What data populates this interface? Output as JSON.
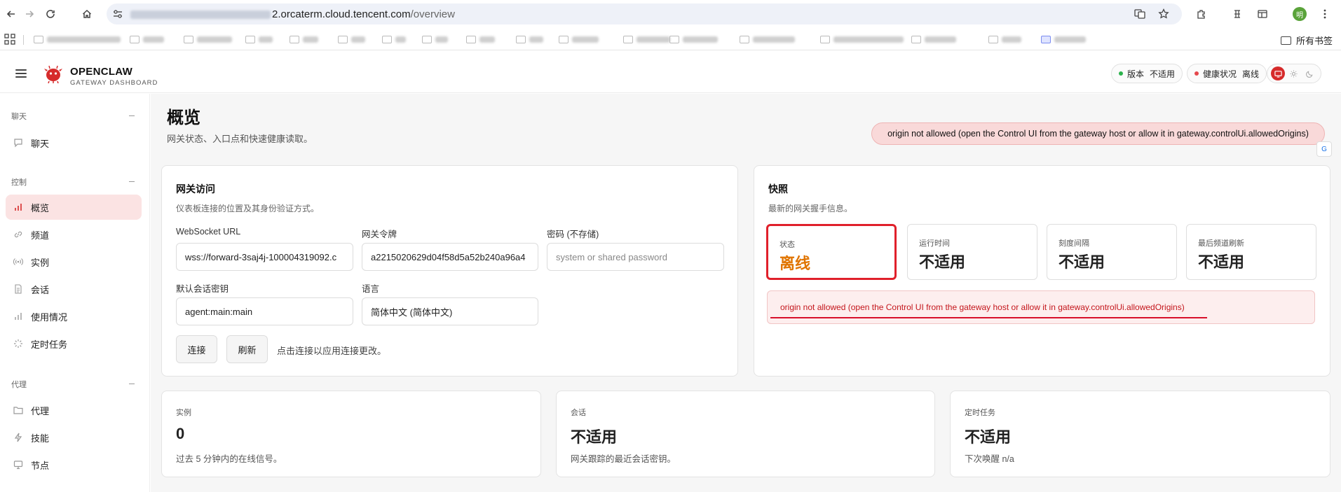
{
  "browser": {
    "url_host": "2.orcaterm.cloud.tencent.com",
    "url_path": "/overview",
    "all_bookmarks": "所有书签",
    "avatar_letter": "明"
  },
  "header": {
    "brand_title": "OPENCLAW",
    "brand_sub": "GATEWAY DASHBOARD",
    "version_label": "版本",
    "version_value": "不适用",
    "health_label": "健康状况",
    "health_value": "离线",
    "colors": {
      "accent": "#d62b2b",
      "ok": "#2bb24c",
      "error": "#e5484d"
    }
  },
  "sidebar": {
    "sections": [
      {
        "title": "聊天",
        "items": [
          {
            "label": "聊天",
            "icon": "chat-icon"
          }
        ]
      },
      {
        "title": "控制",
        "items": [
          {
            "label": "概览",
            "icon": "bar-chart-icon",
            "active": true
          },
          {
            "label": "频道",
            "icon": "link-icon"
          },
          {
            "label": "实例",
            "icon": "broadcast-icon"
          },
          {
            "label": "会话",
            "icon": "document-icon"
          },
          {
            "label": "使用情况",
            "icon": "bar-chart-icon"
          },
          {
            "label": "定时任务",
            "icon": "loader-icon"
          }
        ]
      },
      {
        "title": "代理",
        "items": [
          {
            "label": "代理",
            "icon": "folder-icon"
          },
          {
            "label": "技能",
            "icon": "bolt-icon"
          },
          {
            "label": "节点",
            "icon": "monitor-icon"
          }
        ]
      }
    ]
  },
  "page": {
    "title": "概览",
    "subtitle": "网关状态、入口点和快速健康读取。",
    "error_banner": "origin not allowed (open the Control UI from the gateway host or allow it in gateway.controlUi.allowedOrigins)"
  },
  "gateway_access": {
    "title": "网关访问",
    "desc": "仪表板连接的位置及其身份验证方式。",
    "ws_label": "WebSocket URL",
    "ws_value": "wss://forward-3saj4j-100004319092.c",
    "token_label": "网关令牌",
    "token_value": "a2215020629d04f58d5a52b240a96a4",
    "password_label": "密码 (不存储)",
    "password_placeholder": "system or shared password",
    "session_key_label": "默认会话密钥",
    "session_key_value": "agent:main:main",
    "language_label": "语言",
    "language_value": "简体中文 (简体中文)",
    "connect": "连接",
    "refresh": "刷新",
    "hint": "点击连接以应用连接更改。"
  },
  "snapshot": {
    "title": "快照",
    "desc": "最新的网关握手信息。",
    "stats": [
      {
        "label": "状态",
        "value": "离线"
      },
      {
        "label": "运行时间",
        "value": "不适用"
      },
      {
        "label": "刻度间隔",
        "value": "不适用"
      },
      {
        "label": "最后频道刷新",
        "value": "不适用"
      }
    ],
    "error": "origin not allowed (open the Control UI from the gateway host or allow it in gateway.controlUi.allowedOrigins)"
  },
  "bottom_cards": [
    {
      "label": "实例",
      "value": "0",
      "note": "过去 5 分钟内的在线信号。"
    },
    {
      "label": "会话",
      "value": "不适用",
      "note": "网关跟踪的最近会话密钥。"
    },
    {
      "label": "定时任务",
      "value": "不适用",
      "note": "下次唤醒 n/a"
    }
  ]
}
